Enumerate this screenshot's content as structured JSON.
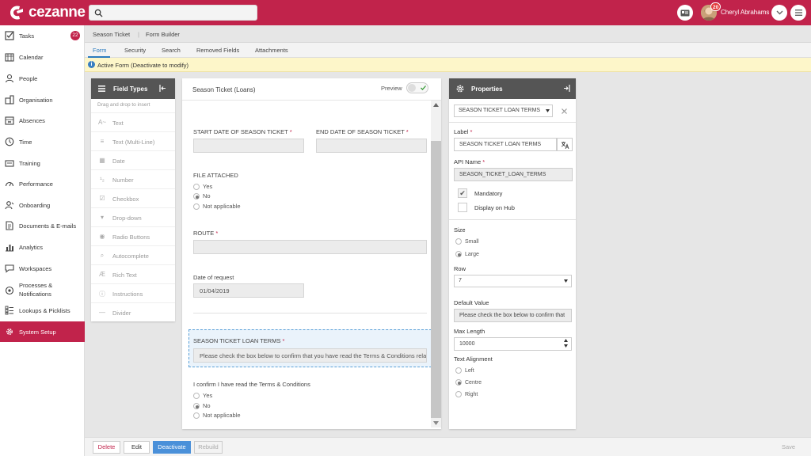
{
  "header": {
    "brand": "cezanne",
    "search": {
      "placeholder": "",
      "value": ""
    },
    "notification_count": "20",
    "user_name": "Cheryl Abrahams",
    "icons": [
      "search-icon",
      "id-card-icon",
      "chevron-down-icon",
      "menu-icon"
    ]
  },
  "sidebar": {
    "items": [
      {
        "label": "Tasks",
        "badge": "22",
        "icon": "checkbox-icon"
      },
      {
        "label": "Calendar",
        "icon": "calendar-icon"
      },
      {
        "label": "People",
        "icon": "person-icon"
      },
      {
        "label": "Organisation",
        "icon": "org-chart-icon"
      },
      {
        "label": "Absences",
        "icon": "absence-calendar-icon"
      },
      {
        "label": "Time",
        "icon": "clock-icon"
      },
      {
        "label": "Training",
        "icon": "training-icon"
      },
      {
        "label": "Performance",
        "icon": "gauge-icon"
      },
      {
        "label": "Onboarding",
        "icon": "onboarding-icon"
      },
      {
        "label": "Documents & E-mails",
        "icon": "document-icon"
      },
      {
        "label": "Analytics",
        "icon": "analytics-icon"
      },
      {
        "label": "Workspaces",
        "icon": "chat-icon"
      },
      {
        "label": "Processes &",
        "label2": "Notifications",
        "icon": "process-icon"
      },
      {
        "label": "Lookups & Picklists",
        "icon": "list-icon"
      },
      {
        "label": "System Setup",
        "icon": "gear-icon",
        "active": true
      }
    ]
  },
  "breadcrumb": {
    "first": "Season Ticket",
    "second": "Form Builder"
  },
  "tabs": [
    "Form",
    "Security",
    "Search",
    "Removed Fields",
    "Attachments"
  ],
  "notice": "Active Form (Deactivate to modify)",
  "field_types": {
    "title": "Field Types",
    "hint": "Drag and drop to insert",
    "items": [
      {
        "label": "Text",
        "icon": "text-icon"
      },
      {
        "label": "Text (Multi-Line)",
        "icon": "multiline-icon"
      },
      {
        "label": "Date",
        "icon": "date-icon"
      },
      {
        "label": "Number",
        "icon": "number-icon"
      },
      {
        "label": "Checkbox",
        "icon": "checkbox-icon"
      },
      {
        "label": "Drop-down",
        "icon": "dropdown-icon"
      },
      {
        "label": "Radio Buttons",
        "icon": "radio-icon"
      },
      {
        "label": "Autocomplete",
        "icon": "magnifier-icon"
      },
      {
        "label": "Rich Text",
        "icon": "rich-text-icon"
      },
      {
        "label": "Instructions",
        "icon": "info-icon"
      },
      {
        "label": "Divider",
        "icon": "divider-icon"
      }
    ]
  },
  "form": {
    "title": "Season Ticket (Loans)",
    "preview_label": "Preview",
    "start_date_label": "START DATE OF SEASON TICKET",
    "end_date_label": "END DATE OF SEASON TICKET",
    "file_attached_label": "FILE ATTACHED",
    "file_options": [
      "Yes",
      "No",
      "Not applicable"
    ],
    "route_label": "ROUTE",
    "date_request_label": "Date of request",
    "date_request_value": "01/04/2019",
    "loan_terms_label": "SEASON TICKET LOAN TERMS",
    "loan_terms_value": "Please check the box below to confirm that you have read the Terms & Conditions relat",
    "confirm_label": "I confirm I have read the Terms & Conditions",
    "confirm_options": [
      "Yes",
      "No",
      "Not applicable"
    ],
    "required_mark": "*"
  },
  "properties": {
    "title": "Properties",
    "field_select": "SEASON TICKET LOAN TERMS",
    "label_label": "Label",
    "label_value": "SEASON TICKET LOAN TERMS",
    "api_label": "API Name",
    "api_value": "SEASON_TICKET_LOAN_TERMS",
    "mandatory": "Mandatory",
    "display_hub": "Display on Hub",
    "size_label": "Size",
    "size_options": [
      "Small",
      "Large"
    ],
    "row_label": "Row",
    "row_value": "7",
    "default_label": "Default Value",
    "default_value": "Please check the box below to confirm that",
    "maxlen_label": "Max Length",
    "maxlen_value": "10000",
    "align_label": "Text Alignment",
    "align_options": [
      "Left",
      "Centre",
      "Right"
    ]
  },
  "footer": {
    "delete": "Delete",
    "edit": "Edit",
    "deactivate": "Deactivate",
    "rebuild": "Rebuild",
    "save": "Save"
  },
  "colors": {
    "brand": "#c1234b",
    "accent": "#2b7bbf",
    "deactivate": "#4a90d9"
  }
}
